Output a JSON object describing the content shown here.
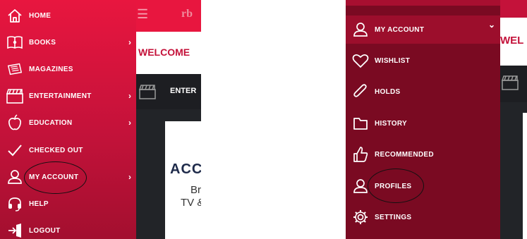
{
  "left_panel": {
    "menu_items": [
      {
        "label": "HOME",
        "icon": "home-icon",
        "has_chevron": false
      },
      {
        "label": "BOOKS",
        "icon": "book-icon",
        "has_chevron": true
      },
      {
        "label": "MAGAZINES",
        "icon": "magazine-icon",
        "has_chevron": false
      },
      {
        "label": "ENTERTAINMENT",
        "icon": "clapperboard-icon",
        "has_chevron": true
      },
      {
        "label": "EDUCATION",
        "icon": "apple-icon",
        "has_chevron": true
      },
      {
        "label": "CHECKED OUT",
        "icon": "checkmark-icon",
        "has_chevron": false
      },
      {
        "label": "MY ACCOUNT",
        "icon": "user-icon",
        "has_chevron": true
      },
      {
        "label": "HELP",
        "icon": "headset-icon",
        "has_chevron": false
      },
      {
        "label": "LOGOUT",
        "icon": "logout-icon",
        "has_chevron": false
      }
    ],
    "chevron": "›",
    "app": {
      "logo": "rb",
      "welcome": "WELCOME",
      "section": "ENTER",
      "card_title": "ACC",
      "card_line1": "Br",
      "card_line2": "TV &"
    }
  },
  "right_panel": {
    "header_item": {
      "label": "MY ACCOUNT",
      "icon": "user-icon",
      "chevron": "⌄"
    },
    "menu_items": [
      {
        "label": "WISHLIST",
        "icon": "heart-icon"
      },
      {
        "label": "HOLDS",
        "icon": "paperclip-icon"
      },
      {
        "label": "HISTORY",
        "icon": "folder-icon"
      },
      {
        "label": "RECOMMENDED",
        "icon": "thumbs-up-icon"
      },
      {
        "label": "PROFILES",
        "icon": "user-icon"
      },
      {
        "label": "SETTINGS",
        "icon": "gear-icon"
      }
    ],
    "app": {
      "welcome": "WEL"
    }
  },
  "colors": {
    "menu_red": "#e8163f",
    "menu_dark_red": "#7a0a22",
    "app_dark": "#222428"
  }
}
